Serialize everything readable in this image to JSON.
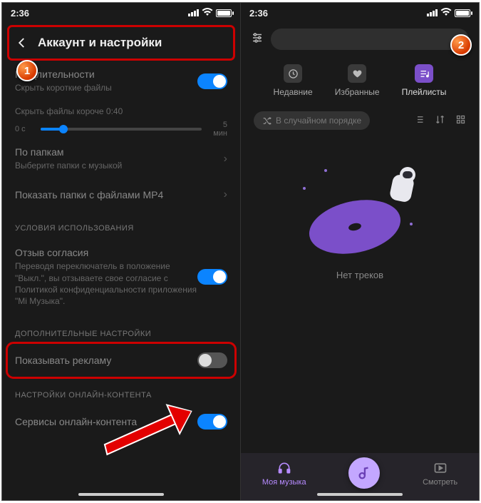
{
  "status": {
    "time": "2:36"
  },
  "left": {
    "header": "Аккаунт и настройки",
    "duration": {
      "title": "По длительности",
      "sub": "Скрыть короткие файлы",
      "toggle_on": true
    },
    "slider": {
      "label": "Скрыть файлы короче 0:40",
      "min": "0 с",
      "max": "5 мин"
    },
    "folders": {
      "title": "По папкам",
      "sub": "Выберите папки с музыкой"
    },
    "mp4": {
      "title": "Показать папки с файлами MP4"
    },
    "terms_hdr": "УСЛОВИЯ ИСПОЛЬЗОВАНИЯ",
    "consent": {
      "title": "Отзыв согласия",
      "sub": "Переводя переключатель в положение \"Выкл.\", вы отзываете свое согласие с Политикой конфиденциальности приложения \"Mi Музыка\".",
      "toggle_on": true
    },
    "extra_hdr": "ДОПОЛНИТЕЛЬНЫЕ НАСТРОЙКИ",
    "ads": {
      "title": "Показывать рекламу",
      "toggle_on": false
    },
    "online_hdr": "НАСТРОЙКИ ОНЛАЙН-КОНТЕНТА",
    "online": {
      "title": "Сервисы онлайн-контента",
      "toggle_on": true
    }
  },
  "right": {
    "tabs": {
      "recent": "Недавние",
      "favorites": "Избранные",
      "playlists": "Плейлисты"
    },
    "shuffle": "В случайном порядке",
    "empty": "Нет треков",
    "nav": {
      "mymusic": "Моя музыка",
      "watch": "Смотреть"
    }
  },
  "badges": {
    "one": "1",
    "two": "2"
  }
}
